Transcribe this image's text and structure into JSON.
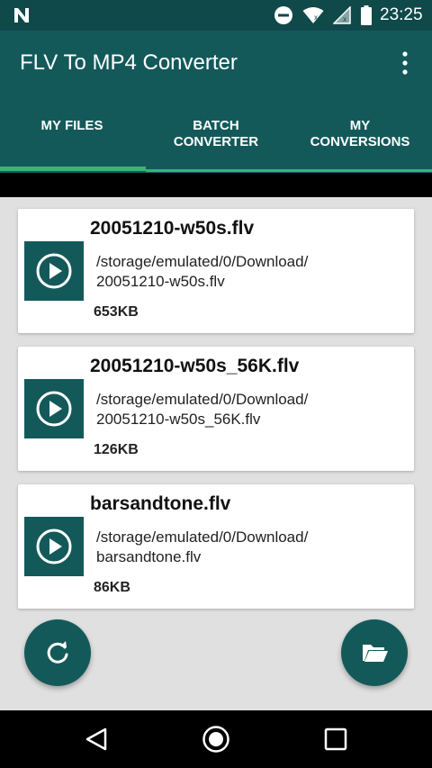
{
  "status_bar": {
    "time": "23:25",
    "icons": [
      "n-icon",
      "do-not-disturb-icon",
      "wifi-icon",
      "signal-icon",
      "battery-icon"
    ]
  },
  "app_bar": {
    "title": "FLV To MP4 Converter",
    "menu_icon": "more-vert-icon"
  },
  "tabs": [
    {
      "label_line1": "MY FILES",
      "label_line2": "",
      "selected": true
    },
    {
      "label_line1": "BATCH",
      "label_line2": "CONVERTER",
      "selected": false
    },
    {
      "label_line1": "MY",
      "label_line2": "CONVERSIONS",
      "selected": false
    }
  ],
  "files": [
    {
      "name": "20051210-w50s.flv",
      "path_line1": "/storage/emulated/0/Download/",
      "path_line2": "20051210-w50s.flv",
      "size": "653KB"
    },
    {
      "name": "20051210-w50s_56K.flv",
      "path_line1": "/storage/emulated/0/Download/",
      "path_line2": "20051210-w50s_56K.flv",
      "size": "126KB"
    },
    {
      "name": "barsandtone.flv",
      "path_line1": "/storage/emulated/0/Download/",
      "path_line2": "barsandtone.flv",
      "size": "86KB"
    }
  ],
  "fabs": {
    "refresh_icon": "refresh-icon",
    "folder_icon": "folder-open-icon"
  },
  "colors": {
    "primary": "#14595a",
    "primary_dark": "#10494a",
    "accent": "#3cb371",
    "background": "#e0e0e0"
  }
}
